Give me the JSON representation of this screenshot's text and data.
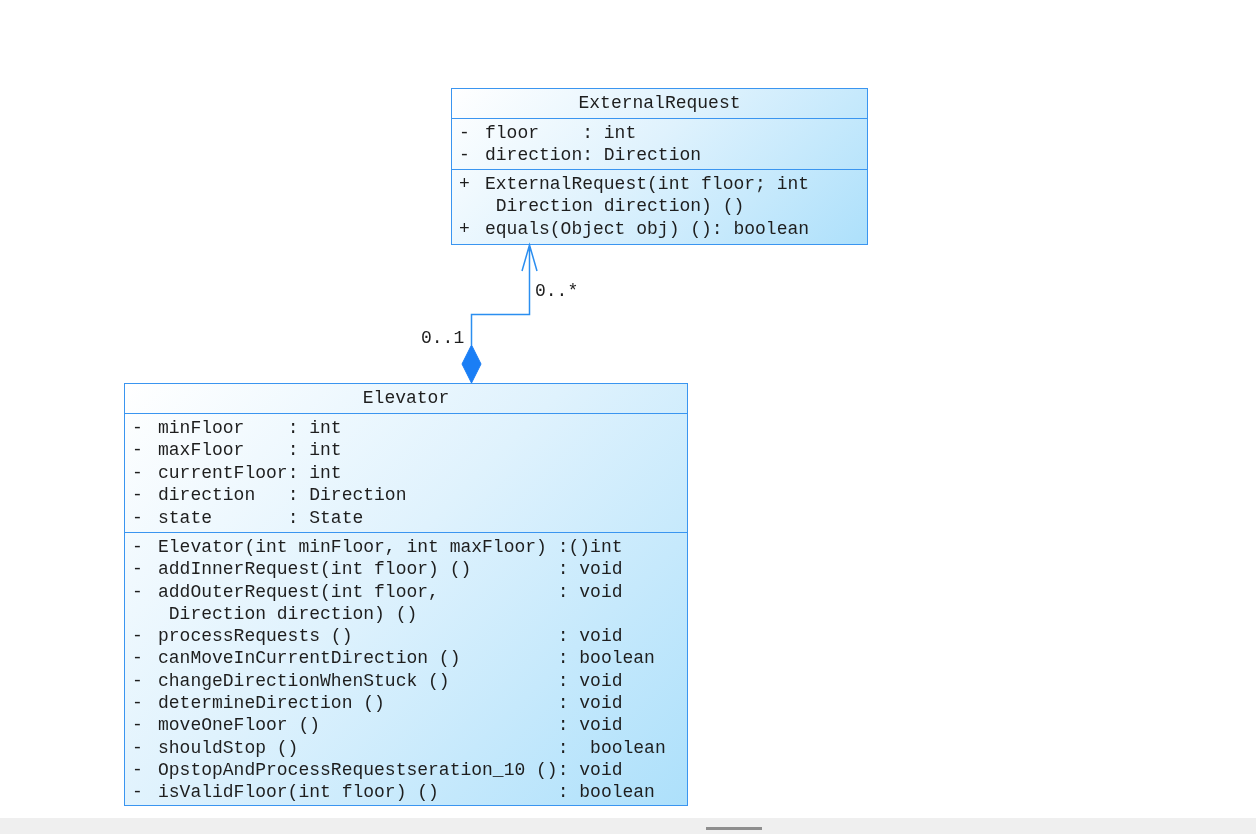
{
  "classes": [
    {
      "name": "ExternalRequest",
      "attributes": [
        {
          "visibility": "-",
          "name": "floor",
          "type": ": int"
        },
        {
          "visibility": "-",
          "name": "direction",
          "type": ": Direction"
        }
      ],
      "operations": [
        {
          "visibility": "+",
          "name": "ExternalRequest(int floor; int\n Direction direction) ()"
        },
        {
          "visibility": "+",
          "name": "equals(Object obj) ()",
          "type": ": boolean"
        }
      ]
    },
    {
      "name": "Elevator",
      "attributes": [
        {
          "visibility": "-",
          "name": "minFloor",
          "type": ": int"
        },
        {
          "visibility": "-",
          "name": "maxFloor",
          "type": ": int"
        },
        {
          "visibility": "-",
          "name": "currentFloor",
          "type": ": int"
        },
        {
          "visibility": "-",
          "name": "direction",
          "type": ": Direction"
        },
        {
          "visibility": "-",
          "name": "state",
          "type": ": State"
        }
      ],
      "operations": [
        {
          "visibility": "-",
          "name": "Elevator(int minFloor, int maxFloor)",
          "type": ":()int"
        },
        {
          "visibility": "-",
          "name": "addInnerRequest(int floor) ()",
          "type": ": void"
        },
        {
          "visibility": "-",
          "name": "addOuterRequest(int floor,\n Direction direction) ()",
          "type": ": void"
        },
        {
          "visibility": "-",
          "name": "processRequests ()",
          "type": ": void"
        },
        {
          "visibility": "-",
          "name": "canMoveInCurrentDirection ()",
          "type": ": boolean"
        },
        {
          "visibility": "-",
          "name": "changeDirectionWhenStuck ()",
          "type": ": void"
        },
        {
          "visibility": "-",
          "name": "determineDirection ()",
          "type": ": void"
        },
        {
          "visibility": "-",
          "name": "moveOneFloor ()",
          "type": ": void"
        },
        {
          "visibility": "-",
          "name": "shouldStop ()",
          "type": ":  boolean"
        },
        {
          "visibility": "-",
          "name": "OpstopAndProcessRequestseration_10 ()",
          "type": ": void"
        },
        {
          "visibility": "-",
          "name": "isValidFloor(int floor) ()",
          "type": ": boolean"
        }
      ]
    }
  ],
  "association": {
    "kind": "composition",
    "source_multiplicity": "0..1",
    "target_multiplicity": "0..*"
  }
}
